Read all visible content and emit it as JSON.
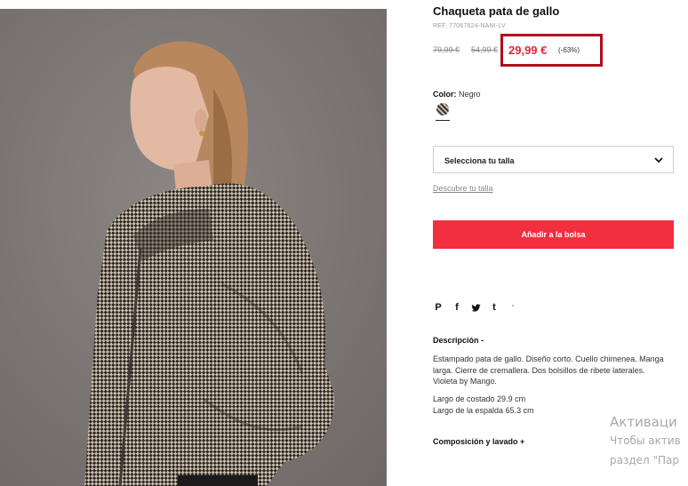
{
  "product": {
    "title": "Chaqueta pata de gallo",
    "ref": "REF. 77067624-NANI-LV",
    "old_price_1": "79,99 €",
    "old_price_2": "54,99 €",
    "current_price": "29,99 €",
    "discount": "(-63%)"
  },
  "color": {
    "label": "Color:",
    "value": "Negro"
  },
  "size": {
    "select_label": "Selecciona tu talla",
    "guide_link": "Descubre tu talla"
  },
  "cart": {
    "add_label": "Añadir a la bolsa"
  },
  "share": {
    "icons": [
      "pinterest-icon",
      "facebook-icon",
      "twitter-icon",
      "tumblr-icon",
      "more-icon"
    ],
    "pinterest": "P",
    "facebook": "f",
    "tumblr": "t",
    "more": "'"
  },
  "description": {
    "title": "Descripción  -",
    "text": "Estampado pata de gallo. Diseño corto. Cuello chimenea. Manga larga. Cierre de cremallera. Dos bolsillos de ribete laterales. Violeta by Mango.",
    "measure_1": "Largo de costado 29.9 cm",
    "measure_2": "Largo de la espalda 65.3 cm"
  },
  "composition": {
    "title": "Composición y lavado  +"
  },
  "os_watermark": {
    "line1": "Активаци",
    "line2": "Чтобы актив",
    "line3": "раздел \"Пар"
  },
  "colors": {
    "price_red": "#e3263b",
    "highlight_border": "#b10d1c",
    "button_red": "#f12f3e",
    "photo_bg": "#7f7977"
  }
}
